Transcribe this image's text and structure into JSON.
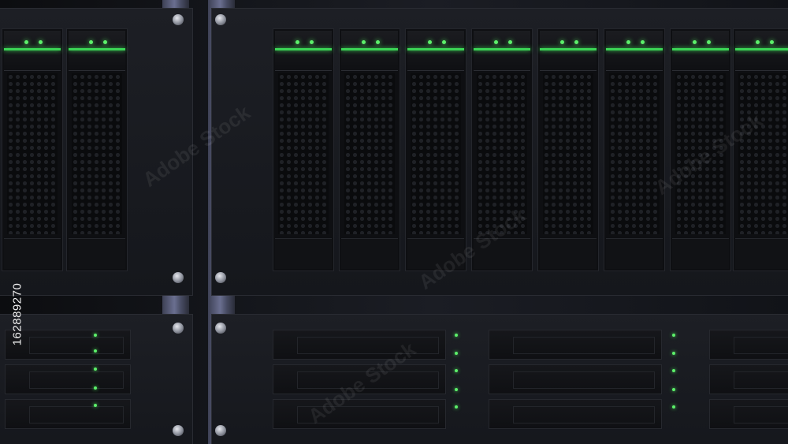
{
  "image": {
    "subject": "server rack with drive bays and green status LEDs",
    "watermark_text": "Adobe Stock",
    "side_id": "162889270",
    "colors": {
      "led_green": "#5cf06a",
      "rail_blue": "#6a6f90",
      "panel_dark": "#15171c"
    }
  }
}
